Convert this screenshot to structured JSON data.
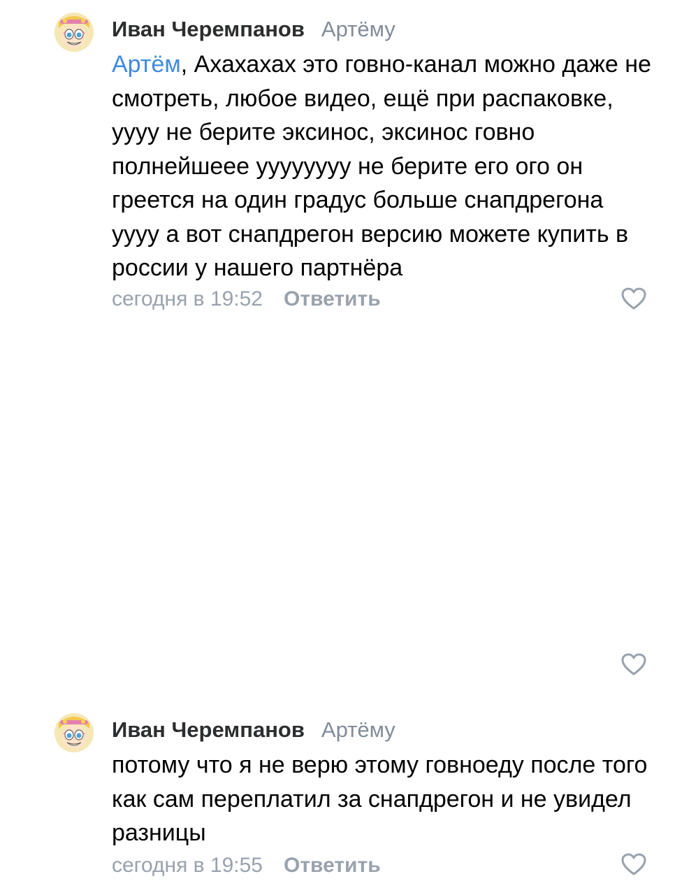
{
  "comments": [
    {
      "author": "Иван Черемпанов",
      "reply_to": "Артёму",
      "mention": "Артём",
      "text_after_mention": ", Ахахахах это говно-канал можно даже не смотреть, любое видео, ещё при распаковке, уууу не берите эксинос, эксинос говно полнейшеее уууууууу не берите его ого он греется на один градус больше снапдрегона уууу а вот снапдрегон версию можете купить в россии у нашего партнёра",
      "timestamp": "сегодня в 19:52",
      "reply_label": "Ответить",
      "like_icon": "heart-outline-icon"
    },
    {
      "author": "Иван Черемпанов",
      "reply_to": "Артёму",
      "text": "потому что я не верю этому говноеду после того как сам переплатил за снапдрегон и не увидел разницы",
      "timestamp": "сегодня в 19:55",
      "reply_label": "Ответить",
      "like_icon": "heart-outline-icon"
    }
  ],
  "orphan_like": {
    "like_icon": "heart-outline-icon"
  },
  "colors": {
    "author": "#2c2d2e",
    "secondary": "#818c99",
    "meta": "#99a2ad",
    "mention": "#3f8ae0",
    "icon": "#99a2ad"
  }
}
